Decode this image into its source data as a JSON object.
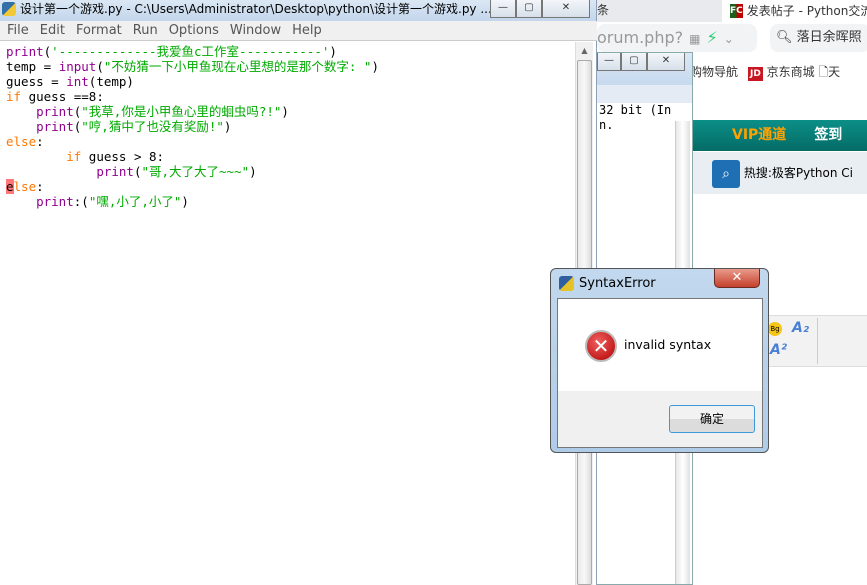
{
  "browser": {
    "tab_left": "条",
    "tab_active": "发表帖子 - Python交流",
    "tab_icon_text": "FC",
    "address_fragment": "orum.php?",
    "search_text": "落日余晖照",
    "bookmarks": [
      "购物导航",
      "京东商城",
      "天"
    ],
    "jd_badge": "JD",
    "banner_items": [
      "VIP通道",
      "签到"
    ],
    "hot_search_label": "热搜:",
    "hot_search_items": "极客Python  Ci",
    "editor_toolbar": {
      "bg": "Bg",
      "a_sub": "A₂",
      "a_sup": "A²"
    }
  },
  "shell": {
    "lines": [
      "32 bit (In",
      "",
      "n."
    ]
  },
  "editor": {
    "title": "设计第一个游戏.py - C:\\Users\\Administrator\\Desktop\\python\\设计第一个游戏.py ...",
    "menu": [
      "File",
      "Edit",
      "Format",
      "Run",
      "Options",
      "Window",
      "Help"
    ],
    "colors": {
      "keyword": "#ff7700",
      "builtin": "#900090",
      "string": "#00aa00",
      "error_highlight": "#ff7777"
    }
  },
  "code": [
    [
      [
        "bi",
        "print"
      ],
      [
        "",
        "("
      ],
      [
        "st",
        "'-------------我爱鱼c工作室-----------'"
      ],
      [
        "",
        ")"
      ]
    ],
    [
      [
        "",
        "temp = "
      ],
      [
        "bi",
        "input"
      ],
      [
        "",
        "("
      ],
      [
        "st",
        "\"不妨猜一下小甲鱼现在心里想的是那个数字: \""
      ],
      [
        "",
        ")"
      ]
    ],
    [
      [
        "",
        "guess = "
      ],
      [
        "bi",
        "int"
      ],
      [
        "",
        "(temp)"
      ]
    ],
    [
      [
        "kw",
        "if"
      ],
      [
        "",
        " guess ==8:"
      ]
    ],
    [
      [
        "",
        "    "
      ],
      [
        "bi",
        "print"
      ],
      [
        "",
        "("
      ],
      [
        "st",
        "\"我草,你是小甲鱼心里的蛔虫吗?!\""
      ],
      [
        "",
        ")"
      ]
    ],
    [
      [
        "",
        "    "
      ],
      [
        "bi",
        "print"
      ],
      [
        "",
        "("
      ],
      [
        "st",
        "\"哼,猜中了也没有奖励!\""
      ],
      [
        "",
        ")"
      ]
    ],
    [
      [
        "kw",
        "else"
      ],
      [
        "",
        ":"
      ]
    ],
    [
      [
        "",
        "        "
      ],
      [
        "kw",
        "if"
      ],
      [
        "",
        " guess > 8:"
      ]
    ],
    [
      [
        "",
        "            "
      ],
      [
        "bi",
        "print"
      ],
      [
        "",
        "("
      ],
      [
        "st",
        "\"哥,大了大了~~~\""
      ],
      [
        "",
        ")"
      ]
    ],
    [
      [
        "err",
        "e"
      ],
      [
        "kw",
        "lse"
      ],
      [
        "",
        ":"
      ]
    ],
    [
      [
        "",
        "    "
      ],
      [
        "bi",
        "print"
      ],
      [
        "",
        ":("
      ],
      [
        "st",
        "\"嘿,小了,小了\""
      ],
      [
        "",
        ")"
      ]
    ]
  ],
  "dialog": {
    "title": "SyntaxError",
    "message": "invalid syntax",
    "ok_label": "确定",
    "close_glyph": "✕",
    "error_glyph": "✕"
  }
}
